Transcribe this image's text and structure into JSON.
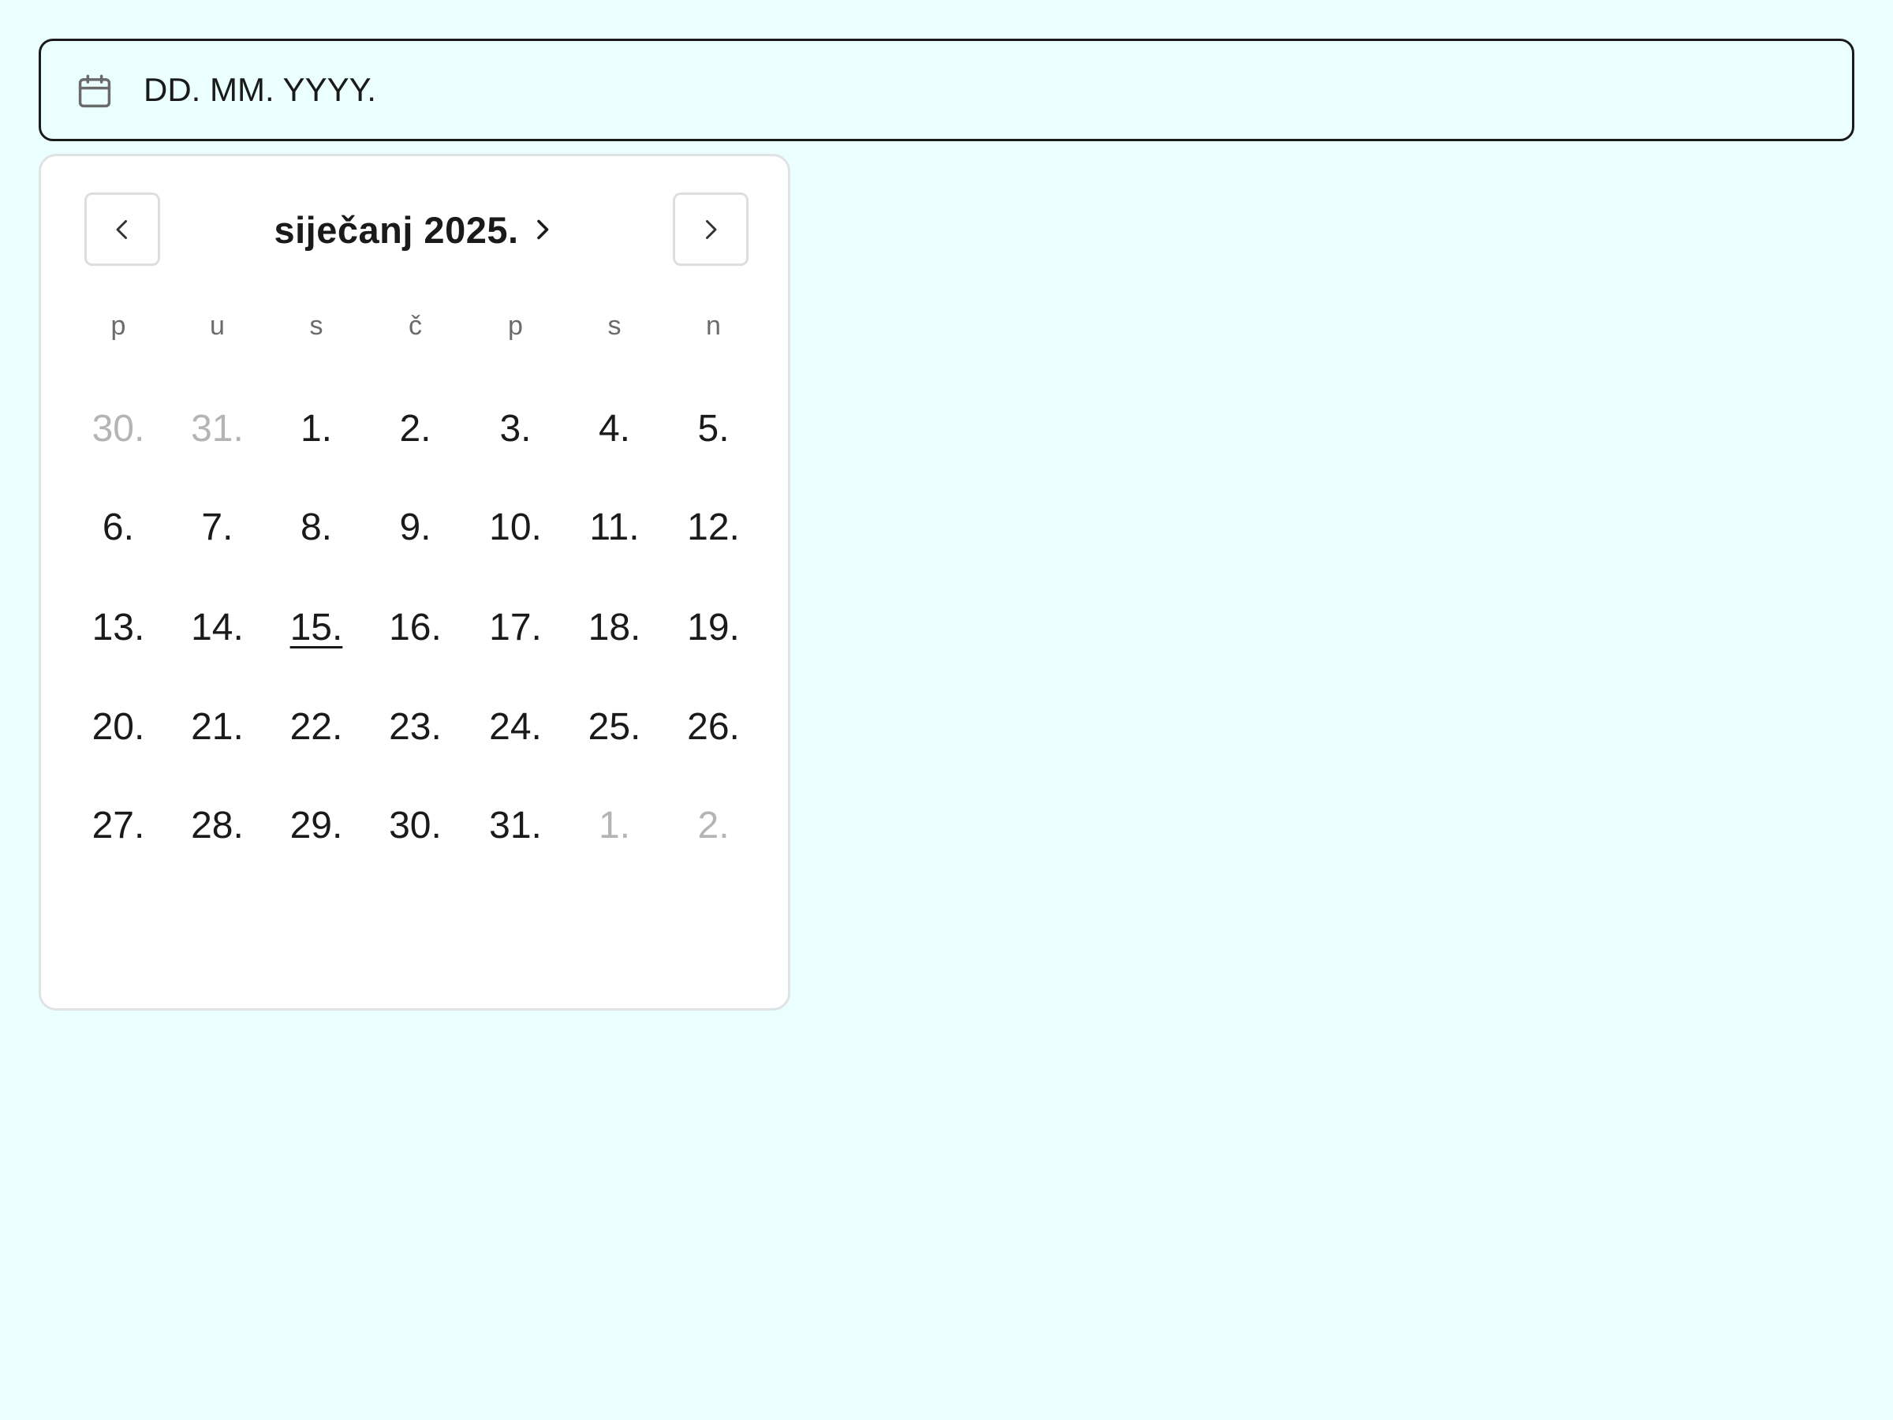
{
  "date_input": {
    "placeholder": "DD. MM. YYYY.",
    "value": "",
    "icon": "calendar-icon"
  },
  "calendar": {
    "month_label": "siječanj 2025.",
    "prev_icon": "chevron-left-icon",
    "next_icon": "chevron-right-icon",
    "month_toggle_icon": "chevron-right-icon",
    "weekdays": [
      "p",
      "u",
      "s",
      "č",
      "p",
      "s",
      "n"
    ],
    "today": "15.",
    "weeks": [
      [
        "30.",
        "31.",
        "1.",
        "2.",
        "3.",
        "4.",
        "5."
      ],
      [
        "6.",
        "7.",
        "8.",
        "9.",
        "10.",
        "11.",
        "12."
      ],
      [
        "13.",
        "14.",
        "15.",
        "16.",
        "17.",
        "18.",
        "19."
      ],
      [
        "20.",
        "21.",
        "22.",
        "23.",
        "24.",
        "25.",
        "26."
      ],
      [
        "27.",
        "28.",
        "29.",
        "30.",
        "31.",
        "1.",
        "2."
      ]
    ],
    "outside_days": [
      [
        0,
        0
      ],
      [
        0,
        1
      ],
      [
        4,
        5
      ],
      [
        4,
        6
      ]
    ],
    "today_cell": [
      2,
      2
    ]
  },
  "colors": {
    "background": "#ebffff",
    "text": "#1a1a1a",
    "muted_text": "#b4b4b4",
    "weekday_text": "#6b6b6b",
    "border": "#dfe3e6"
  }
}
